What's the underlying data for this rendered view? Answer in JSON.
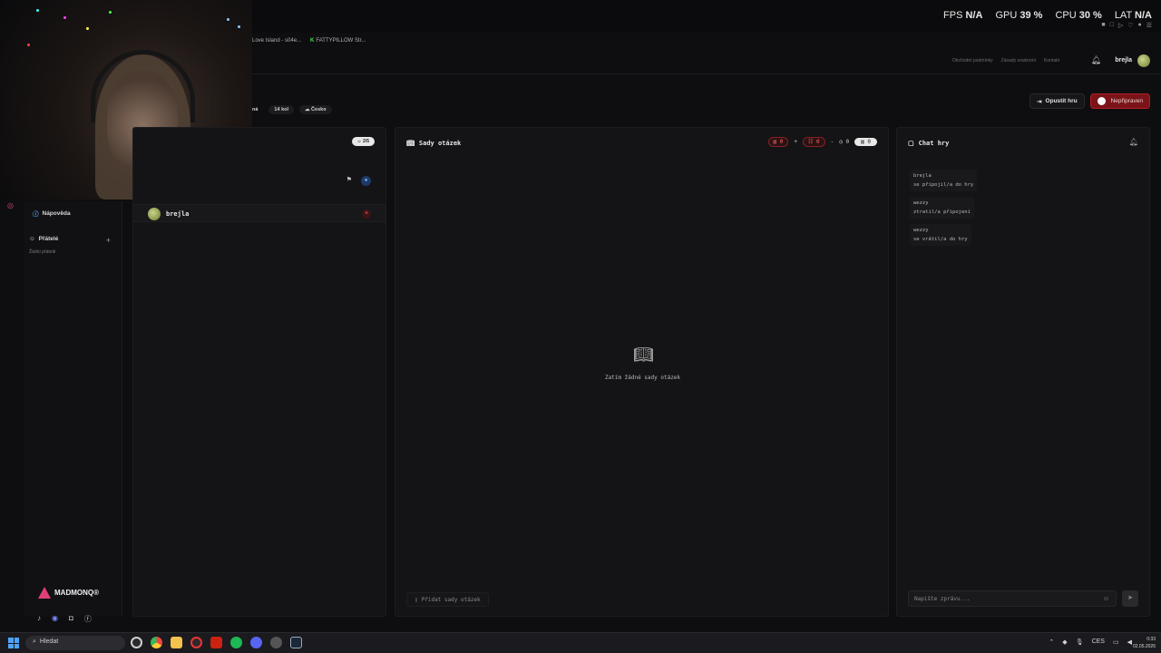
{
  "overlay": {
    "fps_label": "FPS",
    "fps_value": "N/A",
    "gpu_label": "GPU",
    "gpu_value": "39 %",
    "cpu_label": "CPU",
    "cpu_value": "30 %",
    "lat_label": "LAT",
    "lat_value": "N/A"
  },
  "browser_tabs": [
    {
      "label": "Love Island - s04e..."
    },
    {
      "label": "FATTYPILLOW Str..."
    }
  ],
  "header": {
    "nav": [
      "Obchodní podmínky",
      "Zásady soukromí",
      "Kontakt"
    ],
    "username": "brejla"
  },
  "lobby": {
    "chips": [
      "ná",
      "14 kol",
      "Česko"
    ],
    "leave_label": "Opustit hru",
    "ready_label": "Nepřipraven"
  },
  "sidebar": {
    "help_label": "Nápověda",
    "friends_label": "Přátelé",
    "no_friends": "Žádní přátelé",
    "brand": "MADMONQ®"
  },
  "players": {
    "count": "2/5",
    "list": [
      {
        "name": "brejla"
      }
    ]
  },
  "sets": {
    "title": "Sady otázek",
    "stat_1": "0",
    "stat_2": "0",
    "stat_3": "0",
    "stat_4": "0",
    "empty": "Zatím žádné sady otázek",
    "add_label": "Přidat sady otázek"
  },
  "chat": {
    "title": "Chat hry",
    "messages": [
      {
        "user": "brejla",
        "text": "se připojil/a do hry"
      },
      {
        "user": "wezzy",
        "text": "ztratil/a připojení"
      },
      {
        "user": "wezzy",
        "text": "se vrátil/a do hry"
      }
    ],
    "placeholder": "Napište zprávu..."
  },
  "taskbar": {
    "search_label": "Hledat",
    "time": "0:33",
    "date": "02.05.2026"
  },
  "colors": {
    "accent_red": "#b21f25",
    "accent_blue": "#4fa3ff",
    "brand_pink": "#e0407a"
  }
}
